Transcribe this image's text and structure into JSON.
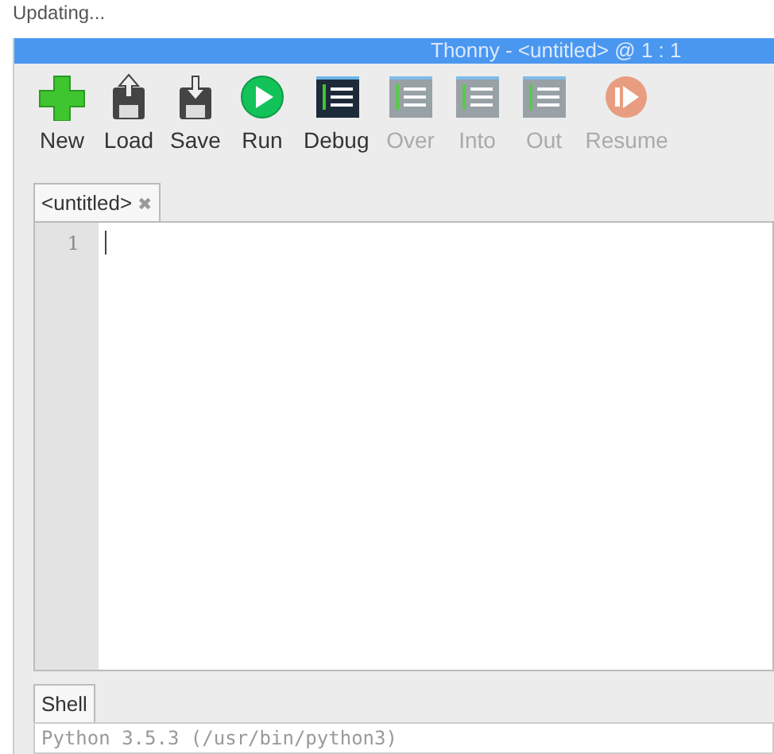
{
  "top_text": "Updating...",
  "window": {
    "title": "Thonny  -  <untitled>  @  1 : 1"
  },
  "toolbar": [
    {
      "kind": "new",
      "label": "New",
      "disabled": false
    },
    {
      "kind": "load",
      "label": "Load",
      "disabled": false
    },
    {
      "kind": "save",
      "label": "Save",
      "disabled": false
    },
    {
      "kind": "run",
      "label": "Run",
      "disabled": false
    },
    {
      "kind": "debug",
      "label": "Debug",
      "disabled": false
    },
    {
      "kind": "over",
      "label": "Over",
      "disabled": true
    },
    {
      "kind": "into",
      "label": "Into",
      "disabled": true
    },
    {
      "kind": "out",
      "label": "Out",
      "disabled": true
    },
    {
      "kind": "resume",
      "label": "Resume",
      "disabled": true
    }
  ],
  "editor_tabs": [
    {
      "label": "<untitled>",
      "close": "✖",
      "selected": true
    }
  ],
  "editor": {
    "line_numbers": [
      "1"
    ]
  },
  "shell_tabs": [
    {
      "label": "Shell",
      "selected": true
    }
  ],
  "shell": {
    "lines": [
      "Python 3.5.3 (/usr/bin/python3)"
    ]
  }
}
